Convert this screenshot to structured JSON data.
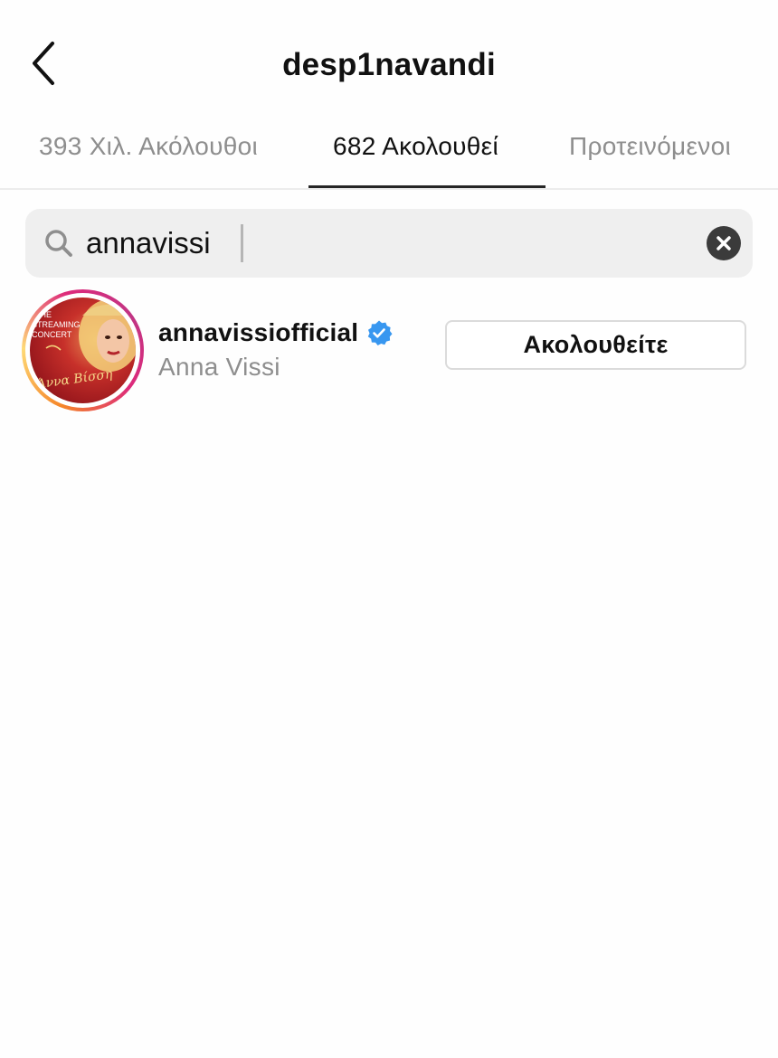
{
  "header": {
    "title": "desp1navandi",
    "back_icon": "chevron-left-icon"
  },
  "tabs": [
    {
      "label": "393 Χιλ. Ακόλουθοι",
      "active": false
    },
    {
      "label": "682 Ακολουθεί",
      "active": true
    },
    {
      "label": "Προτεινόμενοι",
      "active": false
    }
  ],
  "search": {
    "value": "annavissi",
    "icon": "search-icon",
    "clear_icon": "clear-icon"
  },
  "results": [
    {
      "username": "annavissiofficial",
      "full_name": "Anna Vissi",
      "verified": true,
      "button_label": "Ακολουθείτε",
      "avatar_text_1": "THE",
      "avatar_text_2": "STREAMING",
      "avatar_text_3": "CONCERT",
      "avatar_signature": "Άννα Βίσση"
    }
  ],
  "colors": {
    "text_primary": "#111111",
    "text_secondary": "#8e8e8e",
    "search_bg": "#efefef",
    "verified_blue": "#3897f0",
    "button_border": "#dbdbdb"
  }
}
